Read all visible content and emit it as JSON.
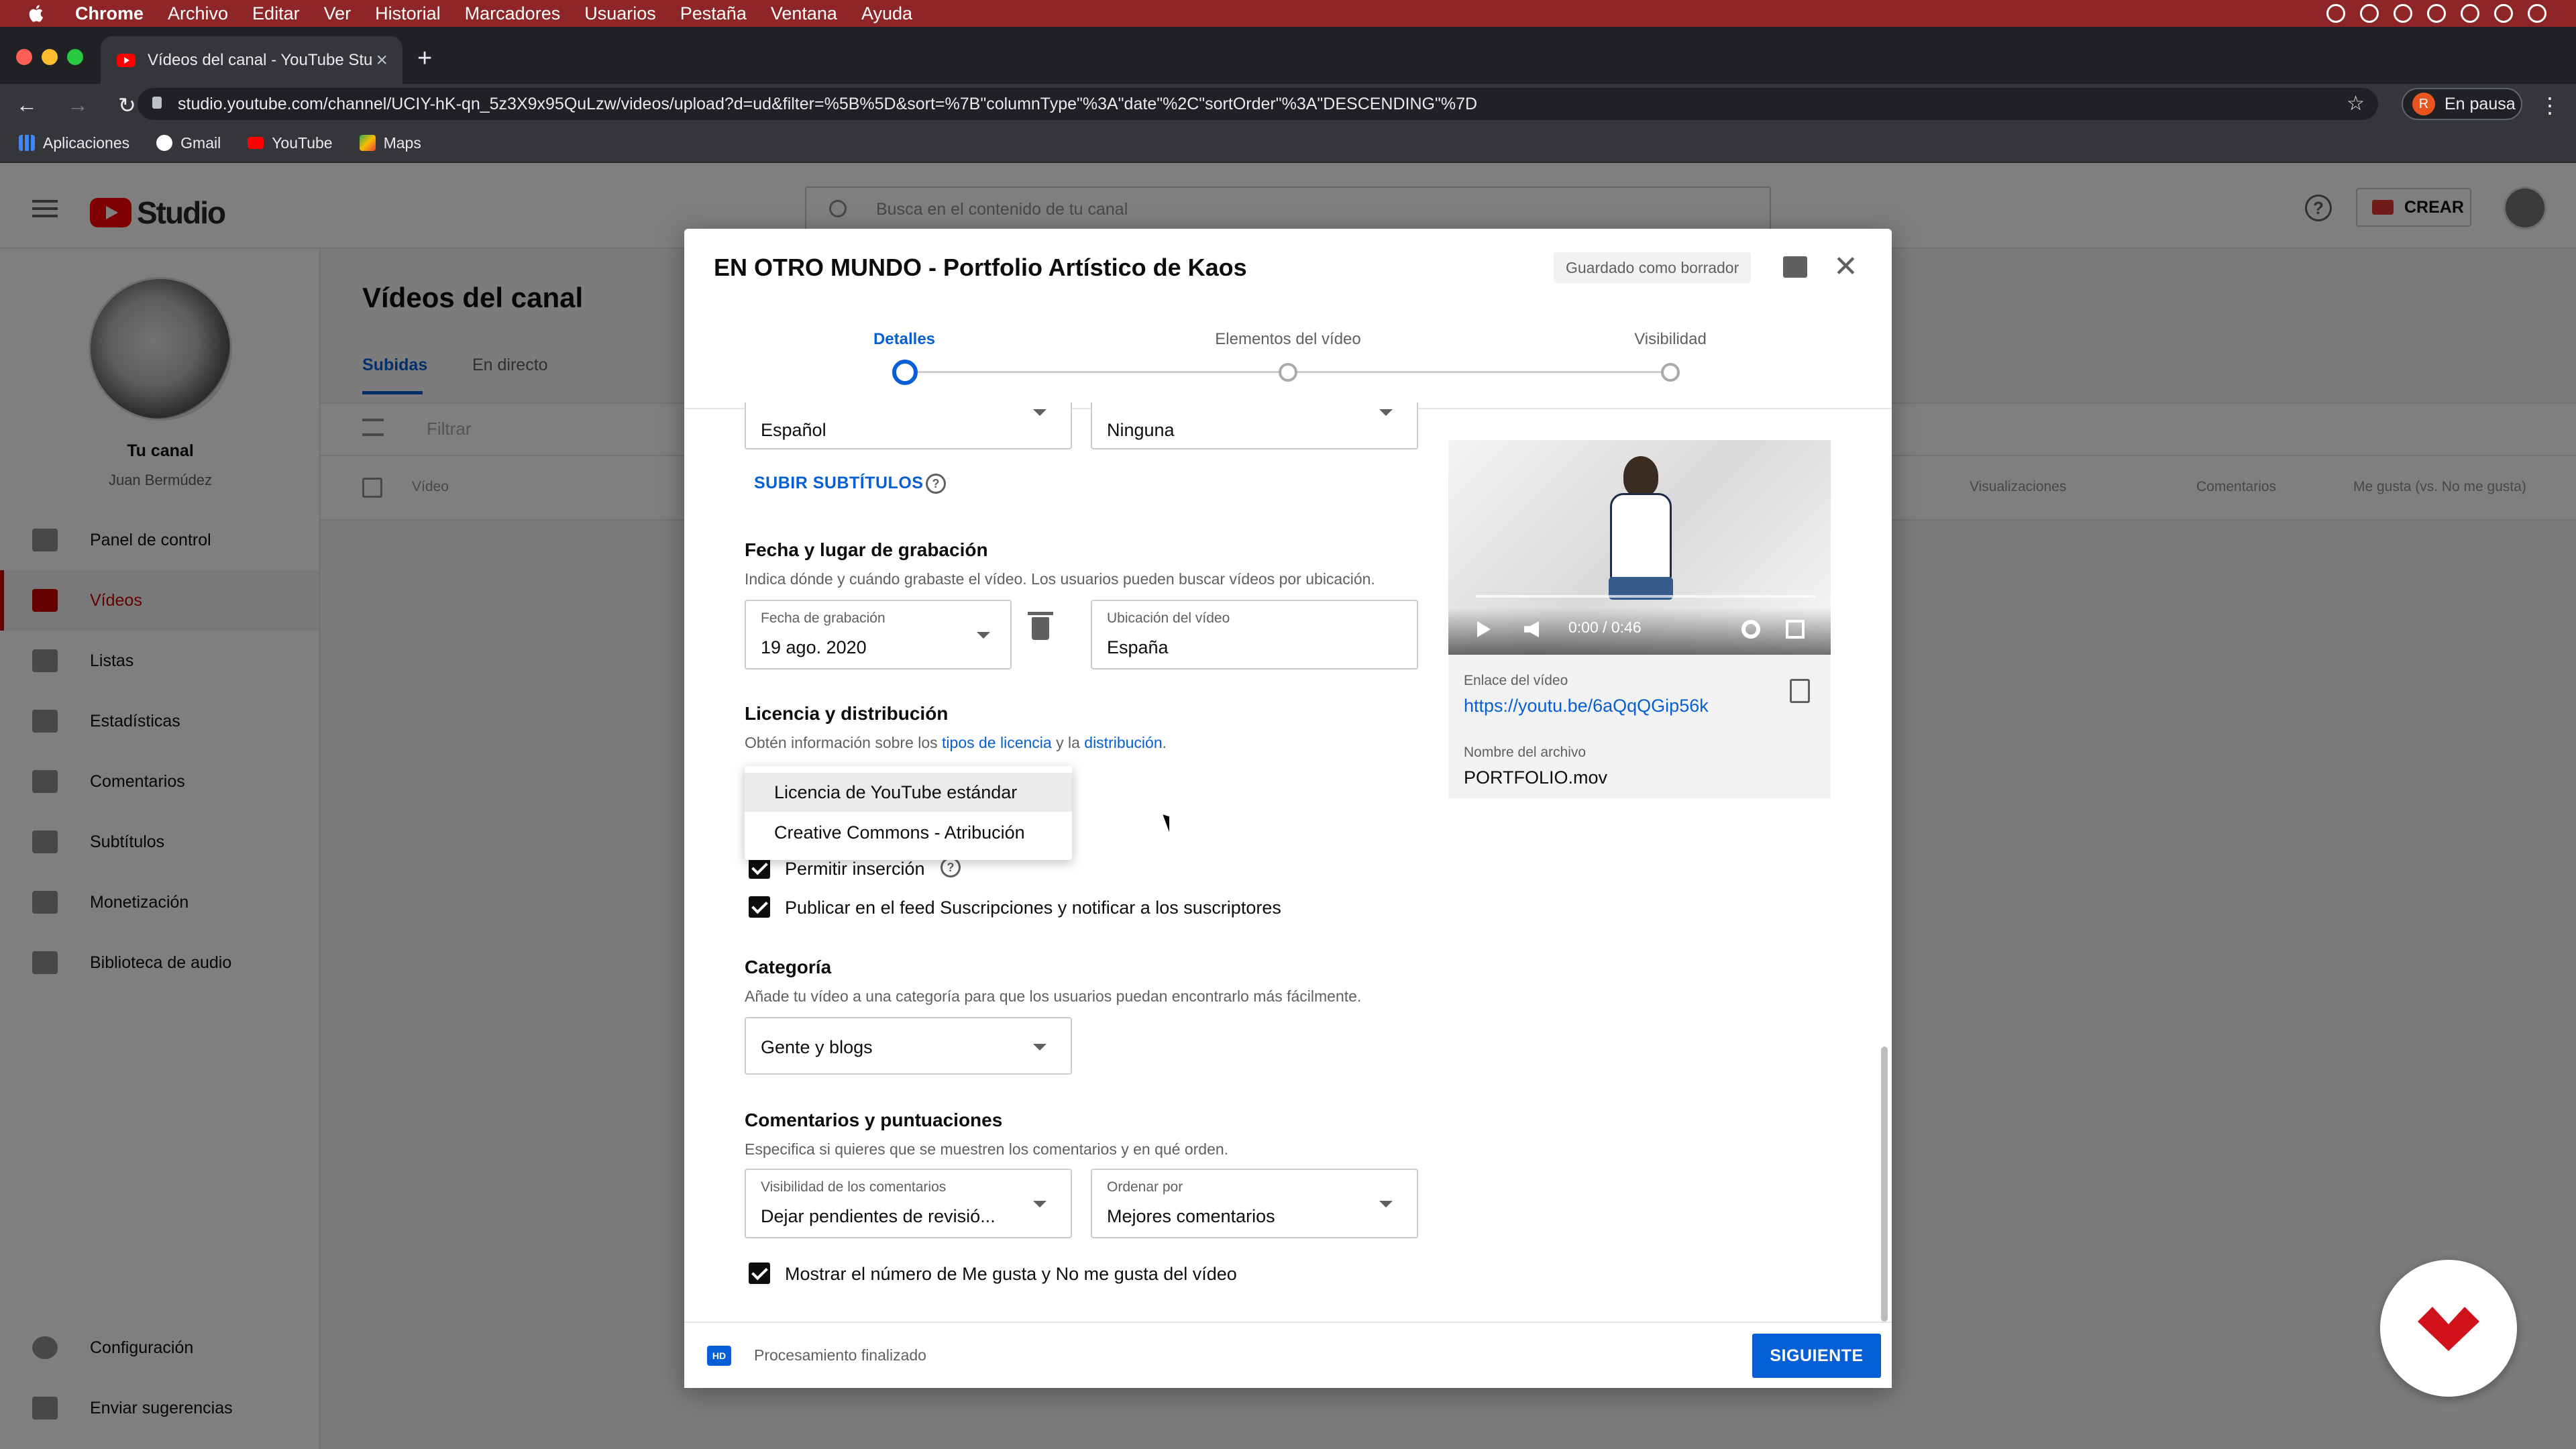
{
  "mac_menu": {
    "app": "Chrome",
    "items": [
      "Archivo",
      "Editar",
      "Ver",
      "Historial",
      "Marcadores",
      "Usuarios",
      "Pestaña",
      "Ventana",
      "Ayuda"
    ]
  },
  "browser": {
    "tab_title": "Vídeos del canal - YouTube Stu",
    "url": "studio.youtube.com/channel/UCIY-hK-qn_5z3X9x95QuLzw/videos/upload?d=ud&filter=%5B%5D&sort=%7B\"columnType\"%3A\"date\"%2C\"sortOrder\"%3A\"DESCENDING\"%7D",
    "profile_initial": "R",
    "profile_status": "En pausa",
    "bookmarks": [
      "Aplicaciones",
      "Gmail",
      "YouTube",
      "Maps"
    ]
  },
  "studio": {
    "logo_text": "Studio",
    "search_placeholder": "Busca en el contenido de tu canal",
    "create_label": "CREAR",
    "channel_title": "Tu canal",
    "channel_name": "Juan Bermúdez",
    "nav": [
      {
        "label": "Panel de control",
        "icon": "dashboard-icon"
      },
      {
        "label": "Vídeos",
        "icon": "videos-icon"
      },
      {
        "label": "Listas",
        "icon": "playlists-icon"
      },
      {
        "label": "Estadísticas",
        "icon": "analytics-icon"
      },
      {
        "label": "Comentarios",
        "icon": "comments-icon"
      },
      {
        "label": "Subtítulos",
        "icon": "subtitles-icon"
      },
      {
        "label": "Monetización",
        "icon": "dollar-icon"
      },
      {
        "label": "Biblioteca de audio",
        "icon": "audio-library-icon"
      }
    ],
    "settings_label": "Configuración",
    "feedback_label": "Enviar sugerencias",
    "page_title": "Vídeos del canal",
    "tabs": [
      "Subidas",
      "En directo"
    ],
    "filter_placeholder": "Filtrar",
    "columns": [
      "Vídeo",
      "Visualizaciones",
      "Comentarios",
      "Me gusta (vs. No me gusta)"
    ]
  },
  "dialog": {
    "title": "EN OTRO MUNDO - Portfolio Artístico de Kaos",
    "draft_status": "Guardado como borrador",
    "steps": [
      "Detalles",
      "Elementos del vídeo",
      "Visibilidad"
    ],
    "language_value": "Español",
    "caption_cert_value": "Ninguna",
    "upload_subtitles": "SUBIR SUBTÍTULOS",
    "recording": {
      "title": "Fecha y lugar de grabación",
      "desc": "Indica dónde y cuándo grabaste el vídeo. Los usuarios pueden buscar vídeos por ubicación.",
      "date_label": "Fecha de grabación",
      "date_value": "19 ago. 2020",
      "location_label": "Ubicación del vídeo",
      "location_value": "España"
    },
    "license": {
      "title": "Licencia y distribución",
      "desc_prefix": "Obtén información sobre los",
      "link1": "tipos de licencia",
      "desc_mid": "y la",
      "link2": "distribución",
      "desc_suffix": ".",
      "options": [
        "Licencia de YouTube estándar",
        "Creative Commons - Atribución"
      ]
    },
    "allow_embed": "Permitir inserción",
    "publish_feed": "Publicar en el feed Suscripciones y notificar a los suscriptores",
    "category": {
      "title": "Categoría",
      "desc": "Añade tu vídeo a una categoría para que los usuarios puedan encontrarlo más fácilmente.",
      "value": "Gente y blogs"
    },
    "comments": {
      "title": "Comentarios y puntuaciones",
      "desc": "Especifica si quieres que se muestren los comentarios y en qué orden.",
      "visibility_label": "Visibilidad de los comentarios",
      "visibility_value": "Dejar pendientes de revisió...",
      "order_label": "Ordenar por",
      "order_value": "Mejores comentarios"
    },
    "show_likes": "Mostrar el número de Me gusta y No me gusta del vídeo",
    "video": {
      "time": "0:00 / 0:46",
      "link_label": "Enlace del vídeo",
      "link": "https://youtu.be/6aQqQGip56k",
      "filename_label": "Nombre del archivo",
      "filename": "PORTFOLIO.mov"
    },
    "footer": {
      "hd_badge": "HD",
      "status": "Procesamiento finalizado",
      "next": "SIGUIENTE"
    }
  },
  "colors": {
    "menubar": "#8e2526",
    "accent_blue": "#065fd4",
    "active_red": "#cc0000"
  }
}
